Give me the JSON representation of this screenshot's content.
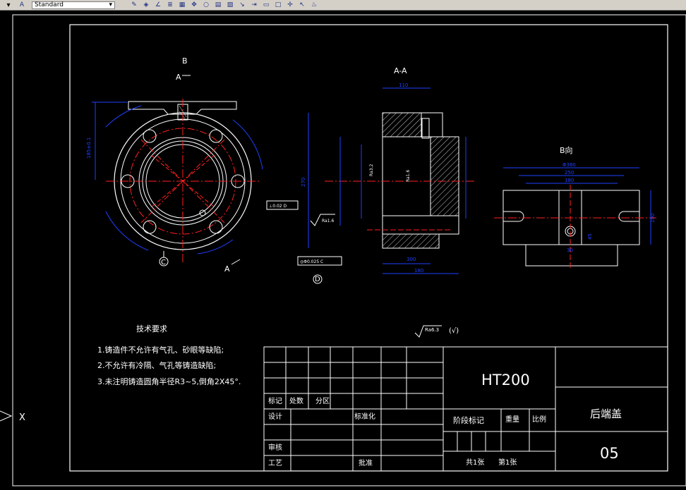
{
  "toolbar": {
    "text_style": "Standard",
    "tools": [
      "pencil-icon",
      "eraser-icon",
      "angle-icon",
      "note-icon",
      "grid-icon",
      "move-icon",
      "circle-icon",
      "table-icon",
      "hatch-icon",
      "arrow-icon",
      "arrow-icon",
      "rect-icon",
      "square-icon",
      "pin-icon",
      "pointer-icon",
      "fire-icon"
    ]
  },
  "drawing": {
    "view_b_label": "B",
    "section_mark_a_top": "A",
    "section_mark_a_bottom": "A",
    "section_title": "A-A",
    "view_b_title": "B向",
    "datum_c": "C",
    "datum_d": "D",
    "roughness_1": "Ra1.6",
    "roughness_2": "Ra3.2",
    "roughness_3": "Ra1.6",
    "roughness_general": "Ra6.3",
    "roughness_general_suffix": "(√)",
    "tech_req_title": "技术要求",
    "tech_req_1": "1.铸造件不允许有气孔、砂眼等缺陷;",
    "tech_req_2": "2.不允许有冷隔、气孔等铸造缺陷;",
    "tech_req_3": "3.未注明铸造圆角半径R3~5,倒角2X45°.",
    "dim_110": "110",
    "dim_270": "270",
    "dim_300": "300",
    "dim_180": "180",
    "dim_phi380": "Φ380",
    "dim_250": "250",
    "dim_180b": "180",
    "dim_30": "30",
    "dim_45": "45",
    "dim_100": "100",
    "tol_frame_1": "⊥0.02 D",
    "tol_frame_2": "◎Φ0.025 C"
  },
  "title_block": {
    "material": "HT200",
    "part_name": "后端盖",
    "drawing_no": "05",
    "row_biaoji": "标记",
    "row_chushu": "处数",
    "row_fenqu": "分区",
    "row_sheji": "设计",
    "row_biaozhunhua": "标准化",
    "row_shenhe": "审核",
    "row_gongyi": "工艺",
    "row_pizhun": "批准",
    "stage_mark": "阶段标记",
    "weight": "重量",
    "scale": "比例",
    "sheets_total": "共1张",
    "sheet_no": "第1张"
  },
  "ucs": {
    "x_label": "X"
  }
}
